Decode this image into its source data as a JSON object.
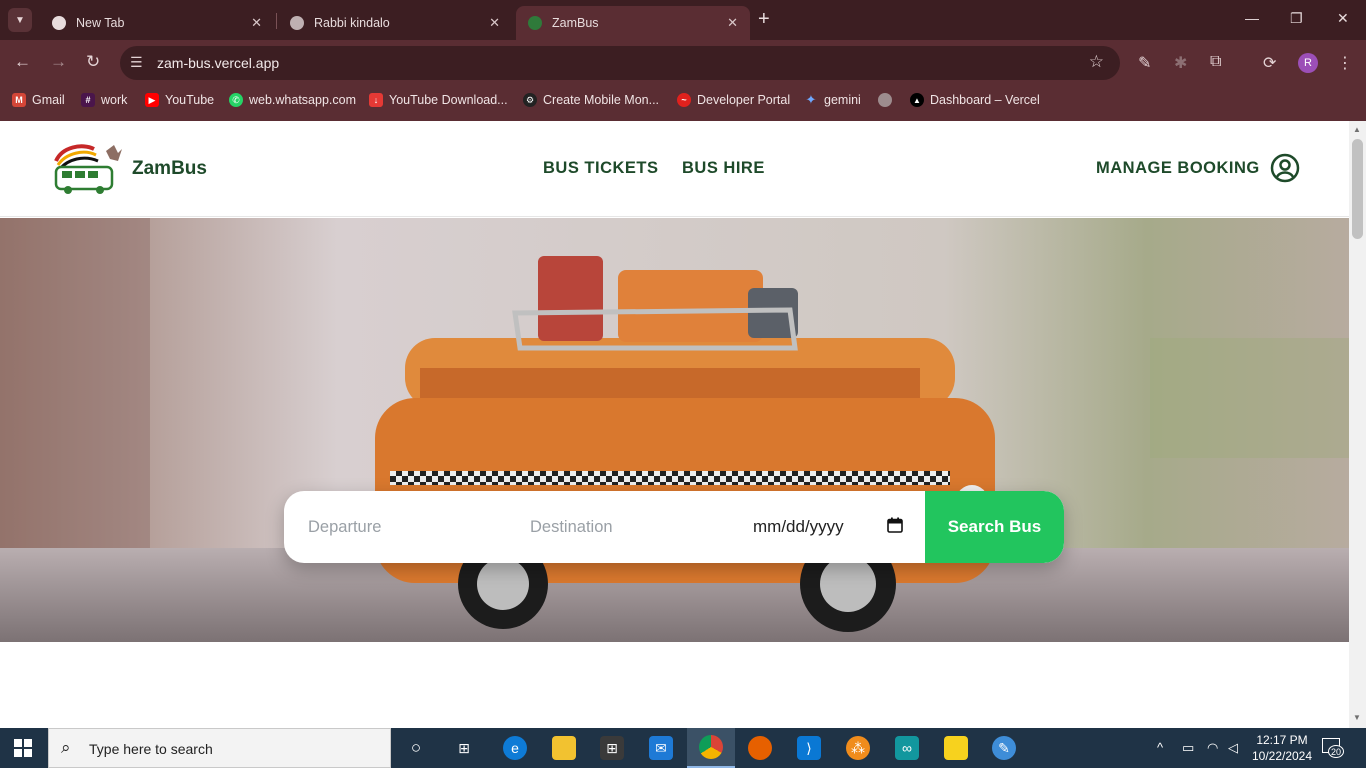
{
  "browser": {
    "tabs": [
      {
        "title": "New Tab",
        "icon": "chrome-icon"
      },
      {
        "title": "Rabbi kindalo",
        "icon": "globe-icon"
      },
      {
        "title": "ZamBus",
        "icon": "zambus-favicon"
      }
    ],
    "url": "zam-bus.vercel.app",
    "profile_initial": "R",
    "bookmarks": [
      {
        "label": "Gmail",
        "icon": "gmail-icon"
      },
      {
        "label": "work",
        "icon": "slack-icon"
      },
      {
        "label": "YouTube",
        "icon": "youtube-icon"
      },
      {
        "label": "web.whatsapp.com",
        "icon": "whatsapp-icon"
      },
      {
        "label": "YouTube Download...",
        "icon": "download-icon"
      },
      {
        "label": "Create Mobile Mon...",
        "icon": "openai-icon"
      },
      {
        "label": "Developer Portal",
        "icon": "developer-portal-icon"
      },
      {
        "label": "gemini",
        "icon": "gemini-icon"
      },
      {
        "label": "",
        "icon": "globe-icon"
      },
      {
        "label": "Dashboard – Vercel",
        "icon": "vercel-icon"
      }
    ]
  },
  "site": {
    "brand": "ZamBus",
    "nav": {
      "bus_tickets": "BUS TICKETS",
      "bus_hire": "BUS HIRE",
      "manage_booking": "MANAGE BOOKING"
    },
    "search": {
      "departure_placeholder": "Departure",
      "destination_placeholder": "Destination",
      "date_placeholder": "mm/dd/yyyy",
      "button": "Search Bus"
    },
    "colors": {
      "brand_green": "#1e4a2a",
      "accent_green": "#22c55e",
      "bus_orange": "#d9782e"
    }
  },
  "taskbar": {
    "search_placeholder": "Type here to search",
    "time": "12:17 PM",
    "date": "10/22/2024",
    "notification_count": "20"
  }
}
